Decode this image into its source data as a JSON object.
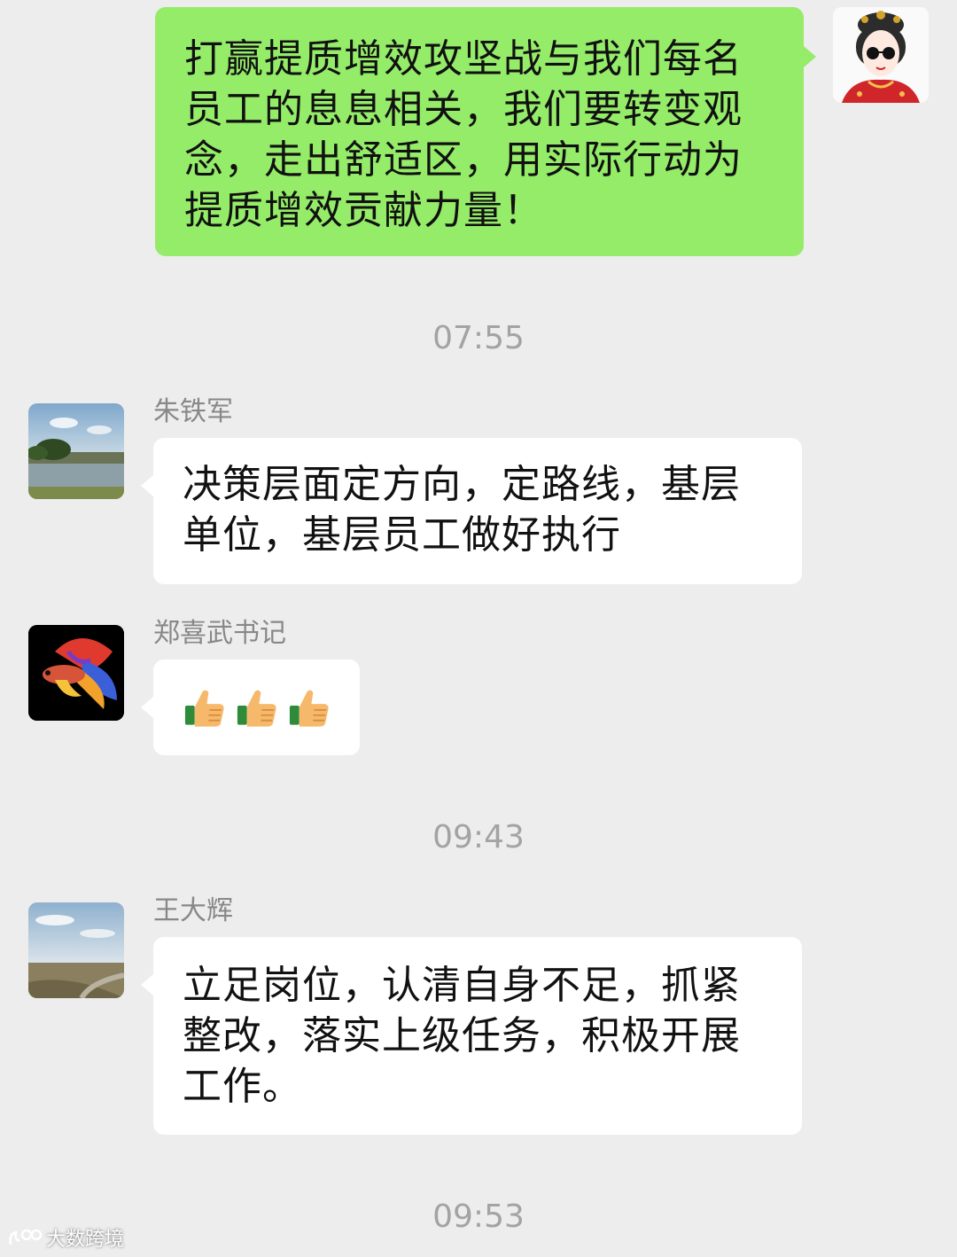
{
  "messages": {
    "m1": {
      "lines": [
        "打赢提质增效攻坚战与我们每名",
        "员工的息息相关，我们要转变观",
        "念，走出舒适区，用实际行动为",
        "提质增效贡献力量！"
      ]
    },
    "t1": "07:55",
    "m2": {
      "sender": "朱铁军",
      "lines": [
        "决策层面定方向，定路线，基层",
        "单位，基层员工做好执行"
      ]
    },
    "m3": {
      "sender": "郑喜武书记",
      "emojis": [
        "thumbs-up",
        "thumbs-up",
        "thumbs-up"
      ]
    },
    "t2": "09:43",
    "m4": {
      "sender": "王大辉",
      "lines": [
        "立足岗位，认清自身不足，抓紧",
        "整改，落实上级任务，积极开展",
        "工作。"
      ]
    },
    "t3": "09:53"
  },
  "watermark": {
    "text": "大数跨境"
  }
}
